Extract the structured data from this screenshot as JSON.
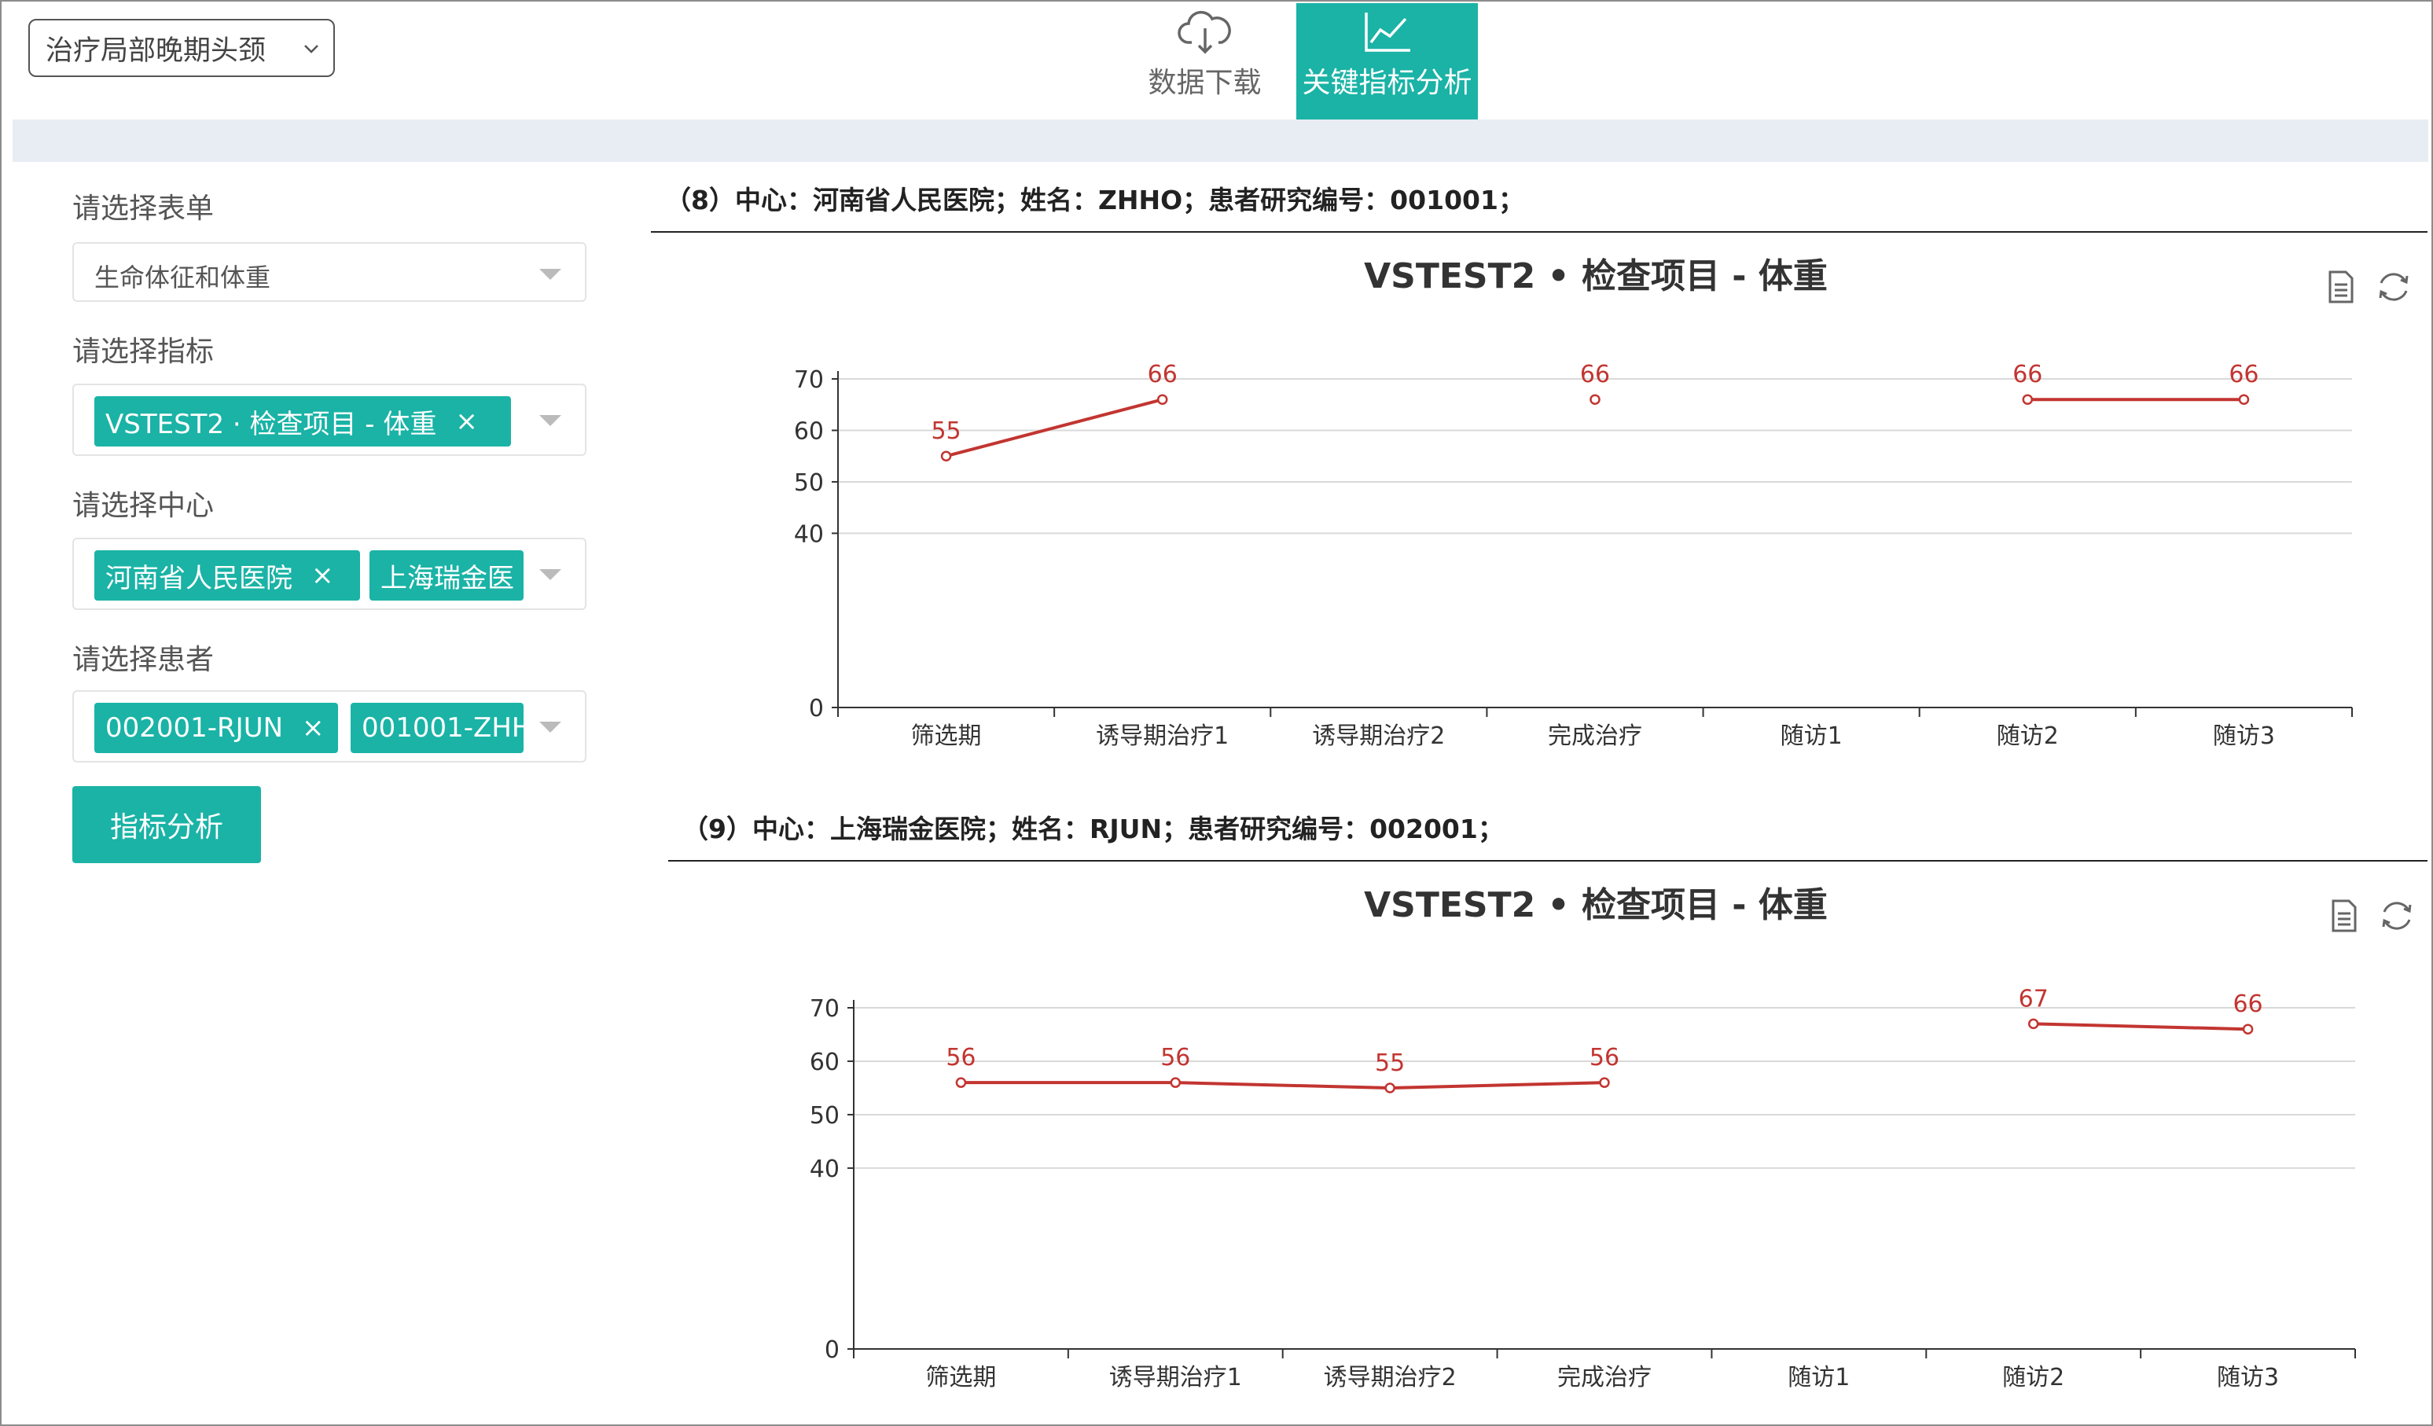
{
  "header": {
    "study_select": "治疗局部晚期头颈",
    "nav": [
      {
        "label": "数据下载",
        "icon": "cloud-download-icon",
        "active": false
      },
      {
        "label": "关键指标分析",
        "icon": "line-chart-icon",
        "active": true
      }
    ]
  },
  "sidebar": {
    "form_label": "请选择表单",
    "form_value": "生命体征和体重",
    "indicator_label": "请选择指标",
    "indicator_tags": [
      "VSTEST2 · 检查项目 - 体重"
    ],
    "center_label": "请选择中心",
    "center_tags": [
      "河南省人民医院",
      "上海瑞金医"
    ],
    "patient_label": "请选择患者",
    "patient_tags": [
      "002001-RJUN",
      "001001-ZHH"
    ],
    "remove_glyph": "×",
    "analyze_button": "指标分析"
  },
  "colors": {
    "accent": "#1ab3a6",
    "series": "#c23531"
  },
  "chart_data": [
    {
      "header": "（8）中心：河南省人民医院；姓名：ZHHO；患者研究编号：001001；",
      "type": "line",
      "title": "VSTEST2 • 检查项目 - 体重",
      "categories": [
        "筛选期",
        "诱导期治疗1",
        "诱导期治疗2",
        "完成治疗",
        "随访1",
        "随访2",
        "随访3"
      ],
      "series": [
        {
          "values": [
            55,
            66,
            null,
            66,
            null,
            66,
            66
          ]
        }
      ],
      "yticks": [
        0,
        40,
        50,
        60,
        70
      ],
      "ylim": [
        0,
        70
      ],
      "toolbox": [
        "data-view-icon",
        "restore-icon"
      ]
    },
    {
      "header": "（9）中心：上海瑞金医院；姓名：RJUN；患者研究编号：002001；",
      "type": "line",
      "title": "VSTEST2 • 检查项目 - 体重",
      "categories": [
        "筛选期",
        "诱导期治疗1",
        "诱导期治疗2",
        "完成治疗",
        "随访1",
        "随访2",
        "随访3"
      ],
      "series": [
        {
          "values": [
            56,
            56,
            55,
            56,
            null,
            67,
            66
          ]
        }
      ],
      "yticks": [
        0,
        40,
        50,
        60,
        70
      ],
      "ylim": [
        0,
        70
      ],
      "toolbox": [
        "data-view-icon",
        "restore-icon"
      ]
    }
  ]
}
